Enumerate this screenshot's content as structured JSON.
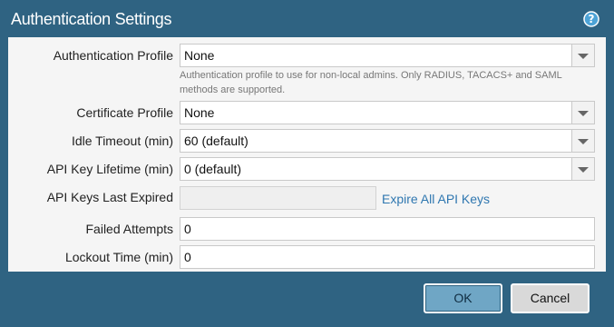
{
  "dialog": {
    "title": "Authentication Settings",
    "help_icon": "help-icon"
  },
  "form": {
    "authentication_profile": {
      "label": "Authentication Profile",
      "value": "None"
    },
    "help_text": "Authentication profile to use for non-local admins. Only RADIUS, TACACS+ and SAML methods are supported.",
    "certificate_profile": {
      "label": "Certificate Profile",
      "value": "None"
    },
    "idle_timeout": {
      "label": "Idle Timeout (min)",
      "value": "60 (default)"
    },
    "api_key_lifetime": {
      "label": "API Key Lifetime (min)",
      "value": "0 (default)"
    },
    "api_keys_last_expired": {
      "label": "API Keys Last Expired",
      "value": ""
    },
    "expire_link": "Expire All API Keys",
    "failed_attempts": {
      "label": "Failed Attempts",
      "value": "0"
    },
    "lockout_time": {
      "label": "Lockout Time (min)",
      "value": "0"
    }
  },
  "buttons": {
    "ok": "OK",
    "cancel": "Cancel"
  }
}
